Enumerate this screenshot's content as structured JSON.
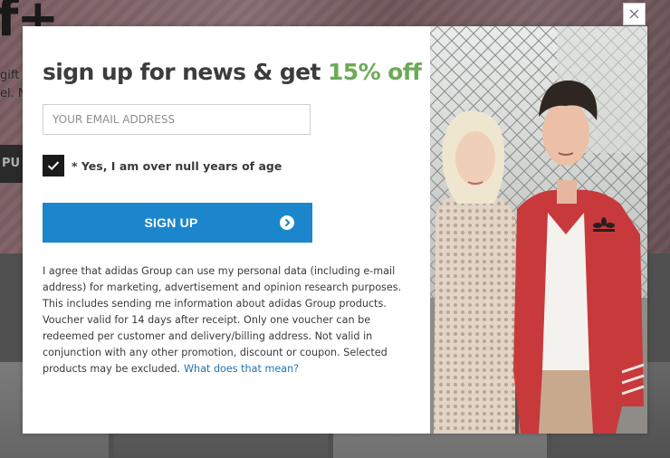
{
  "background": {
    "logo": "f+",
    "text_lines": [
      "gift is",
      "el. N"
    ],
    "button_label": "PU"
  },
  "modal": {
    "headline": "sign up for news & get ",
    "headline_accent": "15% off",
    "email_placeholder": "YOUR EMAIL ADDRESS",
    "age_checkbox": {
      "checked": true,
      "label": "* Yes, I am over null years of age"
    },
    "signup_label": "SIGN UP",
    "legal_text": "I agree that adidas Group can use my personal data (including e-mail address) for marketing, advertisement and opinion research purposes. This includes sending me information about adidas Group products. Voucher valid for 14 days after receipt. Only one voucher can be redeemed per customer and delivery/billing address. Not valid in conjunction with any other promotion, discount or coupon. Selected products may be excluded.",
    "legal_link": "What does that mean?"
  },
  "icons": {
    "close": "close-icon",
    "check": "checkmark-icon",
    "arrow": "arrow-right-circle-icon",
    "photo_logo": "adidas-trefoil-logo"
  },
  "colors": {
    "accent_green": "#6daa57",
    "button_blue": "#1b86cb",
    "link_blue": "#1f73b6",
    "jacket_red": "#c8393c"
  }
}
